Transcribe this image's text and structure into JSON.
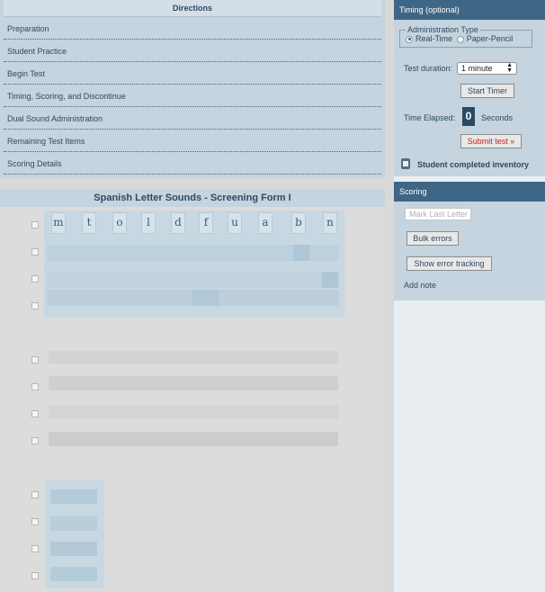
{
  "directions": {
    "title": "Directions",
    "items": [
      "Preparation",
      "Student Practice",
      "Begin Test",
      "Timing, Scoring, and Discontinue",
      "Dual Sound Administration",
      "Remaining Test Items",
      "Scoring Details"
    ]
  },
  "form": {
    "title": "Spanish Letter Sounds - Screening Form I",
    "letters": [
      "m",
      "t",
      "o",
      "l",
      "d",
      "f",
      "u",
      "a",
      "b",
      "n"
    ]
  },
  "timing": {
    "header": "Timing (optional)",
    "admin_type_legend": "Administration Type",
    "realtime_label": "Real-Time",
    "paperpencil_label": "Paper-Pencil",
    "duration_label": "Test duration:",
    "duration_value": "1 minute",
    "start_timer_label": "Start Timer",
    "elapsed_label": "Time Elapsed:",
    "elapsed_value": "0",
    "elapsed_unit": "Seconds",
    "submit_label": "Submit test »",
    "completed_label": "Student completed inventory"
  },
  "scoring": {
    "header": "Scoring",
    "mark_last_placeholder": "Mark Last Letter",
    "bulk_errors_label": "Bulk errors",
    "show_tracking_label": "Show error tracking",
    "add_note_label": "Add note"
  },
  "colors": {
    "panel_bg": "#c5d4de",
    "header_bg": "#3e6686",
    "submit_text": "#cc2020"
  }
}
